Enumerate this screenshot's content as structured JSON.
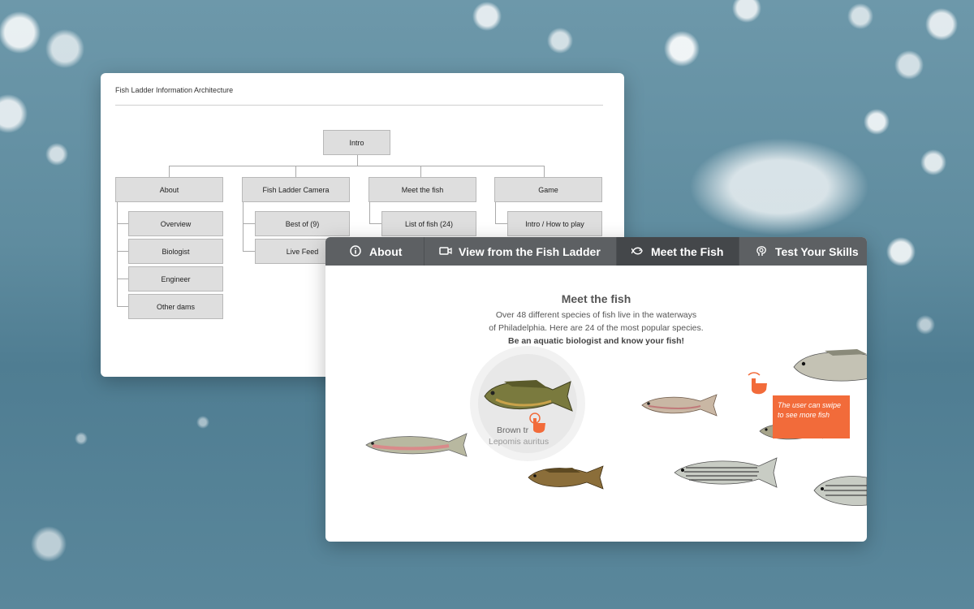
{
  "ia": {
    "title": "Fish Ladder Information Architecture",
    "root": "Intro",
    "columns": [
      {
        "label": "About",
        "children": [
          "Overview",
          "Biologist",
          "Engineer",
          "Other dams"
        ]
      },
      {
        "label": "Fish Ladder Camera",
        "children": [
          "Best of (9)",
          "Live Feed"
        ]
      },
      {
        "label": "Meet the fish",
        "children": [
          "List of fish (24)"
        ]
      },
      {
        "label": "Game",
        "children": [
          "Intro / How to play"
        ]
      }
    ]
  },
  "nav": {
    "tabs": [
      {
        "label": "About",
        "icon": "info-icon"
      },
      {
        "label": "View from the Fish Ladder",
        "icon": "video-camera-icon"
      },
      {
        "label": "Meet the Fish",
        "icon": "fish-icon",
        "active": true
      },
      {
        "label": "Test Your Skills",
        "icon": "brain-icon"
      }
    ]
  },
  "meet": {
    "heading": "Meet the fish",
    "line1": "Over 48 different species of fish live in the waterways",
    "line2": "of Philadelphia. Here are 24 of the most popular species.",
    "line3": "Be an aquatic biologist and know your fish!",
    "selected_common": "Brown tr",
    "selected_latin": "Lepomis auritus",
    "callout": "The user can swipe to see more fish"
  },
  "colors": {
    "accent": "#f26b3a",
    "tabbar": "#5d6063",
    "tab_active": "#44474a"
  }
}
